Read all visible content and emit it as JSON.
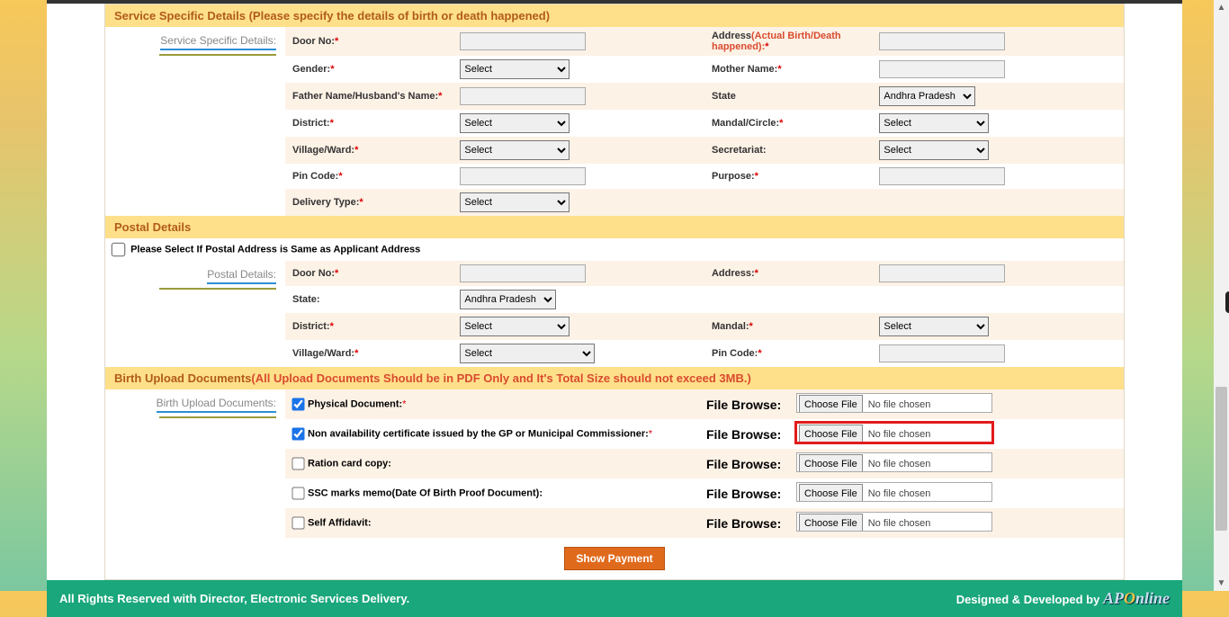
{
  "sections": {
    "service": {
      "header": "Service Specific Details (Please specify the details of birth or death happened)",
      "side_label": "Service Specific Details:",
      "rows": {
        "door_no": "Door No:",
        "address": "Address",
        "address_note": "(Actual Birth/Death happened):",
        "gender": "Gender:",
        "mother": "Mother Name:",
        "father": "Father Name/Husband's Name:",
        "state": "State",
        "district": "District:",
        "mandal": "Mandal/Circle:",
        "village": "Village/Ward:",
        "secretariat": "Secretariat:",
        "pincode": "Pin Code:",
        "purpose": "Purpose:",
        "delivery": "Delivery Type:"
      },
      "select_option": "Select",
      "state_option": "Andhra Pradesh"
    },
    "postal": {
      "header": "Postal Details",
      "check_label": "Please Select If Postal Address is Same as Applicant Address",
      "side_label": "Postal Details:",
      "rows": {
        "door_no": "Door No:",
        "address": "Address:",
        "state": "State:",
        "district": "District:",
        "mandal": "Mandal:",
        "village": "Village/Ward:",
        "pincode": "Pin Code:"
      },
      "select_option": "Select",
      "state_option": "Andhra Pradesh"
    },
    "upload": {
      "header": "Birth Upload Documents",
      "header_note": "(All Upload Documents Should be in PDF Only and It's Total Size should not exceed 3MB.)",
      "side_label": "Birth Upload Documents:",
      "file_browse": "File Browse:",
      "choose_file": "Choose File",
      "no_file": "No file chosen",
      "items": [
        {
          "label": "Physical Document:",
          "required": true,
          "checked": true
        },
        {
          "label": "Non availability certificate issued by the GP or Municipal Commissioner:",
          "required": true,
          "checked": true,
          "highlight": true
        },
        {
          "label": "Ration card copy:",
          "required": false,
          "checked": false
        },
        {
          "label": "SSC marks memo(Date Of Birth Proof Document):",
          "required": false,
          "checked": false
        },
        {
          "label": "Self Affidavit:",
          "required": false,
          "checked": false
        }
      ]
    }
  },
  "buttons": {
    "show_payment": "Show Payment"
  },
  "footer": {
    "left": "All Rights Reserved with Director, Electronic Services Delivery.",
    "right": "Designed & Developed by"
  }
}
